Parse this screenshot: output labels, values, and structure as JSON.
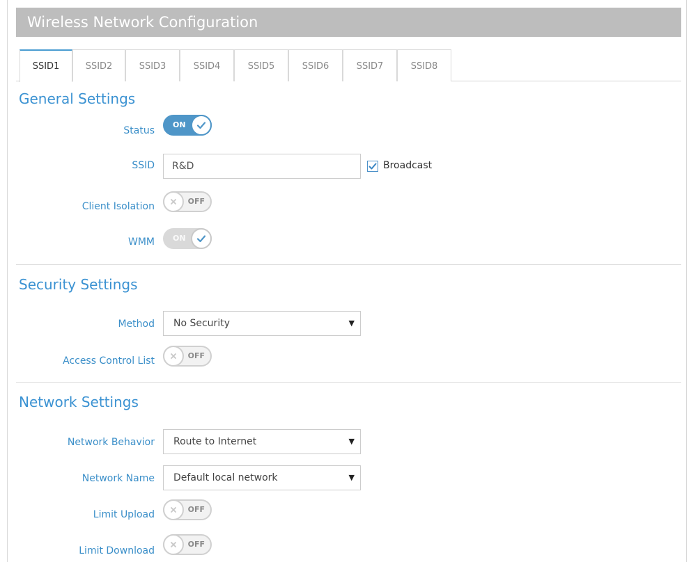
{
  "window": {
    "title": "Wireless Network Configuration"
  },
  "tabs": [
    {
      "label": "SSID1",
      "active": true
    },
    {
      "label": "SSID2",
      "active": false
    },
    {
      "label": "SSID3",
      "active": false
    },
    {
      "label": "SSID4",
      "active": false
    },
    {
      "label": "SSID5",
      "active": false
    },
    {
      "label": "SSID6",
      "active": false
    },
    {
      "label": "SSID7",
      "active": false
    },
    {
      "label": "SSID8",
      "active": false
    }
  ],
  "general": {
    "title": "General Settings",
    "status_label": "Status",
    "status_toggle": "ON",
    "ssid_label": "SSID",
    "ssid_value": "R&D",
    "broadcast_label": "Broadcast",
    "broadcast_checked": true,
    "client_isolation_label": "Client Isolation",
    "client_isolation_toggle": "OFF",
    "wmm_label": "WMM",
    "wmm_toggle": "ON"
  },
  "security": {
    "title": "Security Settings",
    "method_label": "Method",
    "method_value": "No Security",
    "acl_label": "Access Control List",
    "acl_toggle": "OFF"
  },
  "network": {
    "title": "Network Settings",
    "behavior_label": "Network Behavior",
    "behavior_value": "Route to Internet",
    "name_label": "Network Name",
    "name_value": "Default local network",
    "limit_upload_label": "Limit Upload",
    "limit_upload_toggle": "OFF",
    "limit_download_label": "Limit Download",
    "limit_download_toggle": "OFF"
  },
  "icons": {
    "caret": "▼",
    "toggle_on": "check-icon",
    "toggle_off": "x-icon",
    "checkbox": "check-icon"
  },
  "colors": {
    "accent": "#3b92d2",
    "toggle_on": "#4f96c8",
    "titlebar": "#bdbdbd"
  }
}
